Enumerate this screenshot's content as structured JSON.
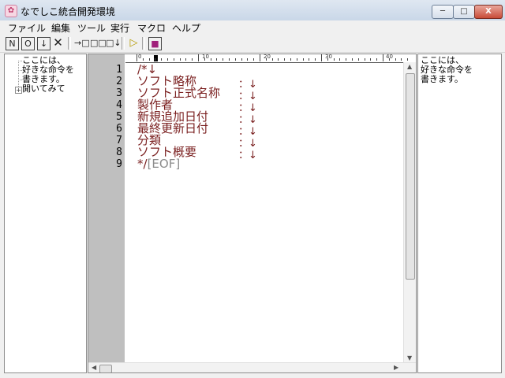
{
  "window": {
    "title": "なでしこ統合開発環境",
    "app_icon": "nadesiko-flower-icon",
    "buttons": {
      "minimize": "─",
      "maximize": "□",
      "close": "X"
    }
  },
  "menu": {
    "items": [
      "ファイル",
      "編集",
      "ツール",
      "実行",
      "マクロ",
      "ヘルプ"
    ]
  },
  "toolbar": {
    "icons": [
      "new-file-icon",
      "open-file-icon",
      "save-file-icon",
      "close-icon",
      "insert-icon",
      "step-icon",
      "step-into-icon",
      "run-icon",
      "stop-icon"
    ]
  },
  "tree": {
    "items": [
      "ここには、",
      "好きな命令を",
      "書きます。",
      "開いてみて"
    ]
  },
  "editor": {
    "ruler": {
      "labels": [
        "0",
        "10",
        "20",
        "30",
        "40"
      ]
    },
    "line_numbers": [
      "1",
      "2",
      "3",
      "4",
      "5",
      "6",
      "7",
      "8",
      "9"
    ],
    "lines": [
      "/*↓",
      "ソフト略称",
      "ソフト正式名称",
      "製作者",
      "新規追加日付",
      "最終更新日付",
      "分類",
      "ソフト概要",
      "*/"
    ],
    "line_marks": [
      "",
      "：↓",
      "：↓",
      "：↓",
      "：↓",
      "：↓",
      "：↓",
      "：↓",
      ""
    ],
    "eof": "[EOF]"
  },
  "help": {
    "lines": [
      "ここには、",
      "好きな命令を",
      "書きます。"
    ]
  }
}
